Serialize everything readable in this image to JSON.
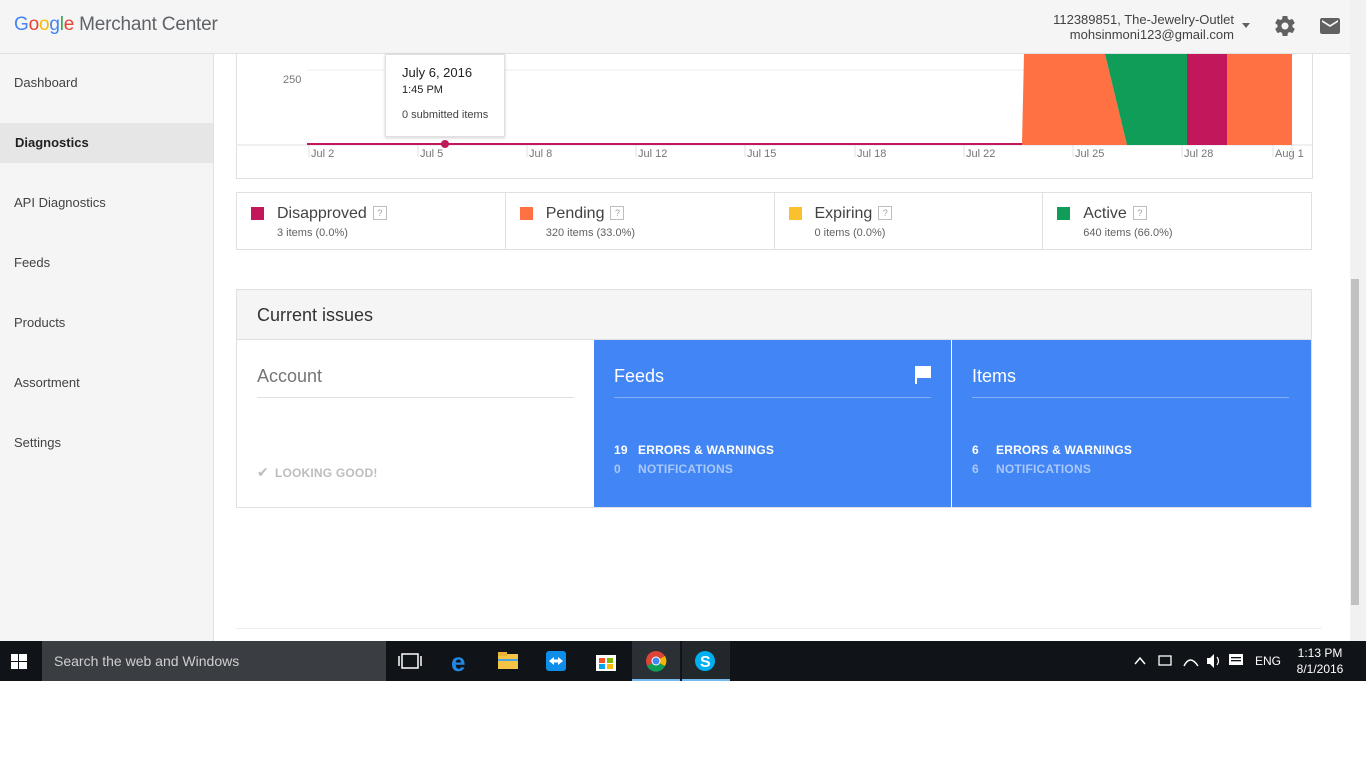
{
  "header": {
    "logo_google": [
      "G",
      "o",
      "o",
      "g",
      "l",
      "e"
    ],
    "logo_product": "Merchant Center",
    "account_line1": "112389851, The-Jewelry-Outlet",
    "account_line2": "mohsinmoni123@gmail.com",
    "icons": [
      "chevron-down-icon",
      "gear-icon",
      "mail-icon"
    ]
  },
  "sidebar": {
    "items": [
      {
        "label": "Dashboard"
      },
      {
        "label": "Diagnostics",
        "active": true
      },
      {
        "label": "API Diagnostics"
      },
      {
        "label": "Feeds"
      },
      {
        "label": "Products"
      },
      {
        "label": "Assortment"
      },
      {
        "label": "Settings"
      }
    ]
  },
  "tooltip": {
    "date": "July 6, 2016",
    "time": "1:45 PM",
    "value": "0 submitted items"
  },
  "chart_data": {
    "type": "area",
    "y_tick_labels": [
      "250"
    ],
    "x_tick_labels": [
      "Jul 2",
      "Jul 5",
      "Jul 8",
      "Jul 12",
      "Jul 15",
      "Jul 18",
      "Jul 22",
      "Jul 25",
      "Jul 28",
      "Aug 1"
    ],
    "series": [
      {
        "name": "Disapproved",
        "color": "#c2185b"
      },
      {
        "name": "Pending",
        "color": "#ff7043"
      },
      {
        "name": "Active",
        "color": "#0f9d58"
      }
    ],
    "highlighted_point": {
      "x": "July 6, 2016",
      "y": 0
    },
    "bands": [
      {
        "series": "Pending",
        "from": "Jul 23",
        "to": "Jul 25"
      },
      {
        "series": "Active",
        "from": "Jul 25",
        "to": "Jul 27"
      },
      {
        "series": "Disapproved",
        "from": "Jul 27",
        "to": "Jul 29"
      },
      {
        "series": "Pending",
        "from": "Jul 29",
        "to": "Aug 1"
      }
    ]
  },
  "stats": [
    {
      "label": "Disapproved",
      "sub": "3 items (0.0%)",
      "color": "#c2185b",
      "help": "?"
    },
    {
      "label": "Pending",
      "sub": "320 items (33.0%)",
      "color": "#ff7043",
      "help": "?"
    },
    {
      "label": "Expiring",
      "sub": "0 items (0.0%)",
      "color": "#fbc02d",
      "help": "?"
    },
    {
      "label": "Active",
      "sub": "640 items (66.0%)",
      "color": "#0f9d58",
      "help": "?"
    }
  ],
  "issues": {
    "title": "Current issues",
    "account": {
      "title": "Account",
      "status": "LOOKING GOOD!"
    },
    "feeds": {
      "title": "Feeds",
      "errors_count": "19",
      "errors_label": "ERRORS & WARNINGS",
      "notifications_count": "0",
      "notifications_label": "NOTIFICATIONS"
    },
    "items": {
      "title": "Items",
      "errors_count": "6",
      "errors_label": "ERRORS & WARNINGS",
      "notifications_count": "6",
      "notifications_label": "NOTIFICATIONS"
    }
  },
  "taskbar": {
    "search_placeholder": "Search the web and Windows",
    "apps": [
      "task-view-icon",
      "edge-icon",
      "file-explorer-icon",
      "teamviewer-icon",
      "store-icon",
      "chrome-icon",
      "skype-icon"
    ],
    "language": "ENG",
    "time": "1:13 PM",
    "date": "8/1/2016"
  }
}
